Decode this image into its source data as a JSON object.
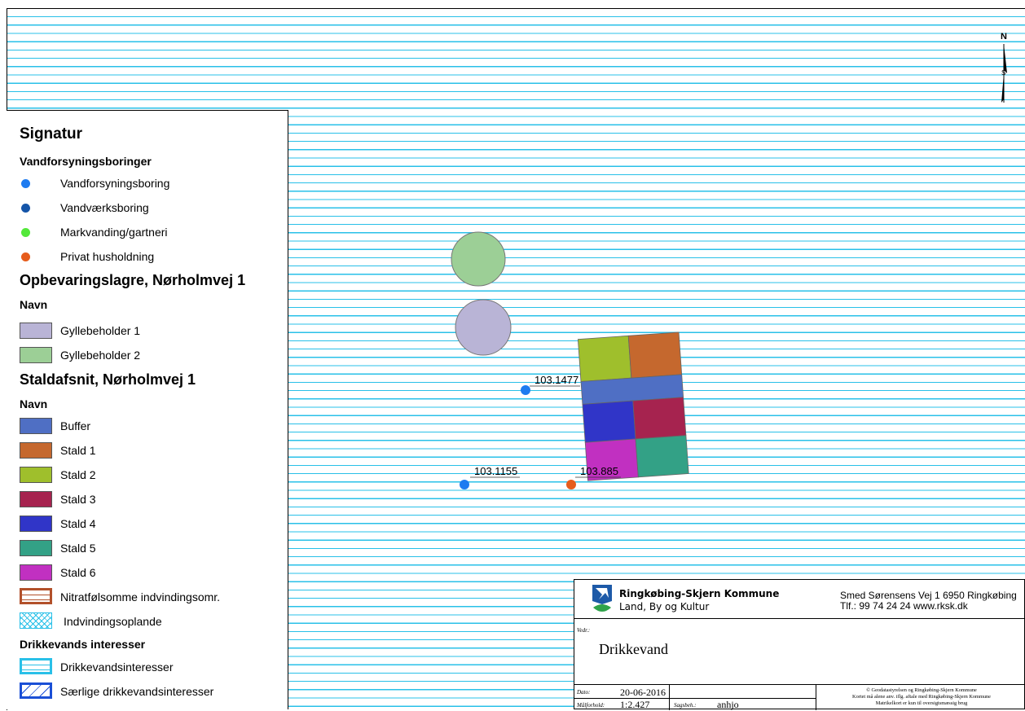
{
  "legend": {
    "title": "Signatur",
    "sections": {
      "boringer": {
        "heading": "Vandforsyningsboringer",
        "items": [
          {
            "label": "Vandforsyningsboring",
            "color": "#1e7bf0"
          },
          {
            "label": "Vandværksboring",
            "color": "#1555a8"
          },
          {
            "label": "Markvanding/gartneri",
            "color": "#53e83a"
          },
          {
            "label": "Privat husholdning",
            "color": "#e65c1c"
          }
        ]
      },
      "lagre": {
        "heading": "Opbevaringslagre, Nørholmvej 1",
        "sub": "Navn",
        "items": [
          {
            "label": "Gyllebeholder 1",
            "color": "#b9b4d6"
          },
          {
            "label": "Gyllebeholder 2",
            "color": "#9ccf96"
          }
        ]
      },
      "stald": {
        "heading": "Staldafsnit, Nørholmvej 1",
        "sub": "Navn",
        "items": [
          {
            "label": "Buffer",
            "color": "#4f6fc4"
          },
          {
            "label": "Stald 1",
            "color": "#c5682e"
          },
          {
            "label": "Stald 2",
            "color": "#9fbf2c"
          },
          {
            "label": "Stald 3",
            "color": "#a6234f"
          },
          {
            "label": "Stald 4",
            "color": "#3035c8"
          },
          {
            "label": "Stald 5",
            "color": "#33a186"
          },
          {
            "label": "Stald 6",
            "color": "#c130c1"
          }
        ]
      },
      "nitrat": {
        "label": "Nitratfølsomme indvindingsomr."
      },
      "opland": {
        "label": "Indvindingsoplande"
      },
      "drikke": {
        "heading": "Drikkevands interesser",
        "items": [
          {
            "label": "Drikkevandsinteresser"
          },
          {
            "label": "Særlige drikkevandsinteresser"
          }
        ]
      }
    }
  },
  "map": {
    "wells": [
      {
        "label": "103.1477",
        "type": "Vandforsyningsboring"
      },
      {
        "label": "103.1155",
        "type": "Vandforsyningsboring"
      },
      {
        "label": "103.885",
        "type": "Privat husholdning"
      }
    ],
    "north_label": "N"
  },
  "titleblock": {
    "org": "Ringkøbing-Skjern Kommune",
    "dept": "Land, By og Kultur",
    "address": "Smed Sørensens Vej 1 6950 Ringkøbing",
    "phone": "Tlf.: 99 74 24 24   www.rksk.dk",
    "vedr_label": "Vedr.:",
    "vedr": "Drikkevand",
    "dato_label": "Dato:",
    "dato": "20-06-2016",
    "maal_label": "Målforhold:",
    "maal": "1:2.427",
    "sags_label": "Sagsbeh.:",
    "sags": "anhjo",
    "copyright1": "© Geodatastyrelsen og Ringkøbing-Skjern Kommune",
    "copyright2": "Kortet må alene anv. iflg. aftale med Ringkøbing-Skjern Kommune",
    "copyright3": "Matrikelkort er kun til oversigtsmæssig brug"
  }
}
